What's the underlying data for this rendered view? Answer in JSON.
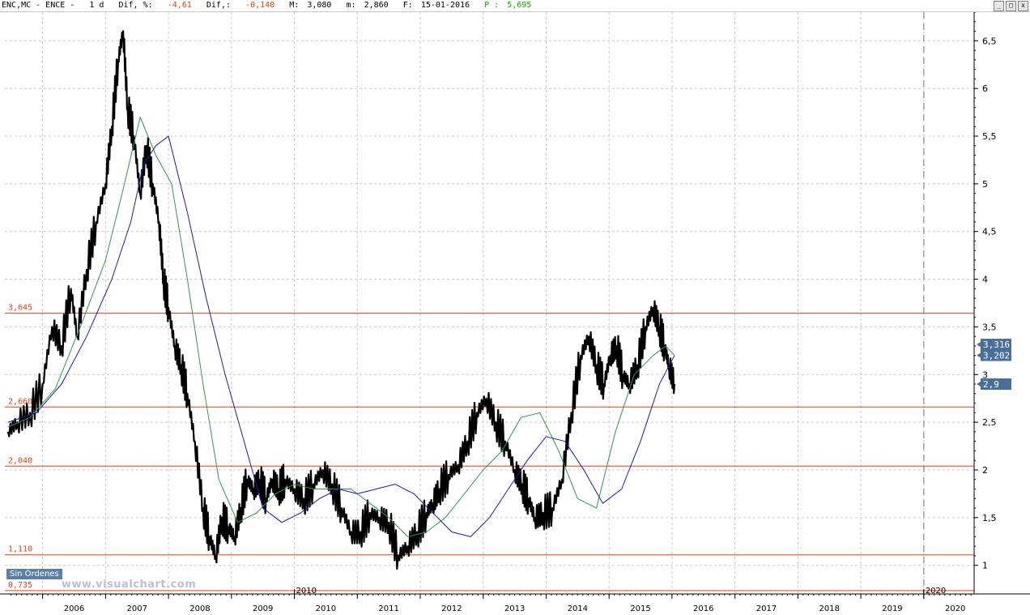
{
  "header": {
    "symbol": "ENC,MC - ENCE -",
    "period": "1 d",
    "dif_label": "Dif, %:",
    "dif_pct": "-4,61",
    "dif_abs_label": "Dif,:",
    "dif_abs": "-0,140",
    "max_label": "M:",
    "max": "3,080",
    "min_label": "m:",
    "min": "2,860",
    "date_label": "F:",
    "date": "15-01-2016",
    "p_label": "P :",
    "p_value": "5,695"
  },
  "window_buttons": [
    "_",
    "□",
    "x"
  ],
  "badge": "Sin Órdenes",
  "watermark": "www.visualchart.com",
  "colors": {
    "price": "#000000",
    "ma_short": "#2a9a4a",
    "ma_long": "#1a1aa8",
    "levels": "#e04010",
    "tag_bg": "#4a6e9a",
    "negative": "#e04010",
    "positive": "#00b000"
  },
  "chart_data": {
    "type": "line",
    "title": "",
    "xlabel": "",
    "ylabel": "",
    "ylim": [
      0.7,
      6.8
    ],
    "xlim": [
      2005.4,
      2020.8
    ],
    "y_ticks": [
      "1",
      "1,5",
      "2",
      "2,5",
      "3",
      "3,5",
      "4",
      "4,5",
      "5",
      "5,5",
      "6",
      "6,5"
    ],
    "x_ticks": [
      "2006",
      "2007",
      "2008",
      "2009",
      "2010",
      "2011",
      "2012",
      "2013",
      "2014",
      "2015",
      "2016",
      "2017",
      "2018",
      "2019",
      "2020"
    ],
    "axis_markers": [
      "2010",
      "2020"
    ],
    "grid": true,
    "levels": [
      {
        "label": "3,645",
        "value": 3.645
      },
      {
        "label": "2,660",
        "value": 2.66
      },
      {
        "label": "2,040",
        "value": 2.04
      },
      {
        "label": "1,110",
        "value": 1.11
      },
      {
        "label": "0,735",
        "value": 0.735
      }
    ],
    "tags": [
      {
        "label": "3,316",
        "value": 3.316
      },
      {
        "label": "3,202",
        "value": 3.202
      },
      {
        "label": "2,9",
        "value": 2.9
      }
    ],
    "series": [
      {
        "x": [
          2005.45,
          2005.6,
          2005.8,
          2006.0,
          2006.15,
          2006.3,
          2006.45,
          2006.55,
          2006.7,
          2006.85,
          2007.0,
          2007.1,
          2007.2,
          2007.28,
          2007.35,
          2007.45,
          2007.55,
          2007.65,
          2007.75,
          2007.85,
          2007.92,
          2008.0,
          2008.1,
          2008.2,
          2008.3,
          2008.42,
          2008.55,
          2008.65,
          2008.75,
          2008.85,
          2008.95,
          2009.05,
          2009.15,
          2009.25,
          2009.35,
          2009.45,
          2009.55,
          2009.65,
          2009.75,
          2009.85,
          2010.0,
          2010.15,
          2010.3,
          2010.45,
          2010.6,
          2010.75,
          2010.9,
          2011.05,
          2011.2,
          2011.35,
          2011.5,
          2011.65,
          2011.8,
          2011.95,
          2012.1,
          2012.2,
          2012.3,
          2012.45,
          2012.6,
          2012.75,
          2012.9,
          2013.05,
          2013.2,
          2013.35,
          2013.5,
          2013.62,
          2013.72,
          2013.82,
          2013.95,
          2014.1,
          2014.25,
          2014.4,
          2014.55,
          2014.68,
          2014.8,
          2014.92,
          2015.02,
          2015.12,
          2015.22,
          2015.32,
          2015.45,
          2015.58,
          2015.7,
          2015.8,
          2015.88,
          2015.95,
          2016.04
        ],
        "values": [
          2.4,
          2.5,
          2.6,
          2.9,
          3.5,
          3.3,
          3.9,
          3.4,
          4.1,
          4.6,
          5.0,
          5.6,
          6.3,
          6.6,
          5.8,
          5.5,
          4.9,
          5.4,
          5.0,
          4.6,
          4.0,
          3.7,
          3.3,
          3.1,
          2.8,
          2.3,
          1.6,
          1.3,
          1.1,
          1.5,
          1.4,
          1.3,
          1.6,
          1.9,
          1.8,
          1.9,
          1.7,
          1.9,
          1.8,
          1.9,
          1.8,
          1.7,
          1.85,
          2.0,
          1.85,
          1.6,
          1.35,
          1.35,
          1.55,
          1.5,
          1.45,
          1.1,
          1.2,
          1.35,
          1.55,
          1.65,
          1.8,
          1.95,
          2.05,
          2.3,
          2.6,
          2.75,
          2.5,
          2.3,
          2.0,
          1.85,
          1.7,
          1.5,
          1.55,
          1.6,
          1.9,
          2.6,
          3.2,
          3.4,
          3.1,
          2.9,
          3.2,
          3.3,
          3.0,
          2.9,
          3.1,
          3.5,
          3.7,
          3.5,
          3.3,
          3.1,
          2.9
        ]
      },
      {
        "x": [
          2005.45,
          2005.8,
          2006.2,
          2006.6,
          2007.0,
          2007.3,
          2007.55,
          2007.8,
          2008.05,
          2008.3,
          2008.55,
          2008.8,
          2009.1,
          2009.4,
          2009.7,
          2010.0,
          2010.3,
          2010.6,
          2010.9,
          2011.2,
          2011.5,
          2011.8,
          2012.1,
          2012.4,
          2012.7,
          2013.0,
          2013.3,
          2013.6,
          2013.9,
          2014.2,
          2014.5,
          2014.8,
          2015.1,
          2015.4,
          2015.7,
          2015.9,
          2016.04
        ],
        "values": [
          2.45,
          2.55,
          2.85,
          3.5,
          4.2,
          5.0,
          5.7,
          5.3,
          5.0,
          4.0,
          2.9,
          1.9,
          1.45,
          1.55,
          1.75,
          1.85,
          1.8,
          1.8,
          1.8,
          1.65,
          1.5,
          1.3,
          1.35,
          1.5,
          1.75,
          2.0,
          2.2,
          2.55,
          2.6,
          2.2,
          1.7,
          1.6,
          2.4,
          3.0,
          3.2,
          3.3,
          3.2
        ]
      },
      {
        "x": [
          2005.45,
          2005.9,
          2006.3,
          2006.7,
          2007.1,
          2007.4,
          2007.6,
          2007.8,
          2008.0,
          2008.3,
          2008.6,
          2008.9,
          2009.2,
          2009.5,
          2009.8,
          2010.1,
          2010.4,
          2010.7,
          2011.0,
          2011.3,
          2011.6,
          2011.9,
          2012.2,
          2012.5,
          2012.8,
          2013.1,
          2013.4,
          2013.7,
          2014.0,
          2014.3,
          2014.6,
          2014.9,
          2015.2,
          2015.5,
          2015.8,
          2016.04
        ],
        "values": [
          2.5,
          2.6,
          2.9,
          3.4,
          4.0,
          4.6,
          5.2,
          5.4,
          5.5,
          4.7,
          3.8,
          3.0,
          2.3,
          1.6,
          1.45,
          1.55,
          1.7,
          1.8,
          1.75,
          1.8,
          1.85,
          1.75,
          1.55,
          1.35,
          1.3,
          1.5,
          1.8,
          2.1,
          2.35,
          2.3,
          2.0,
          1.65,
          1.8,
          2.3,
          2.9,
          3.2
        ]
      }
    ]
  }
}
